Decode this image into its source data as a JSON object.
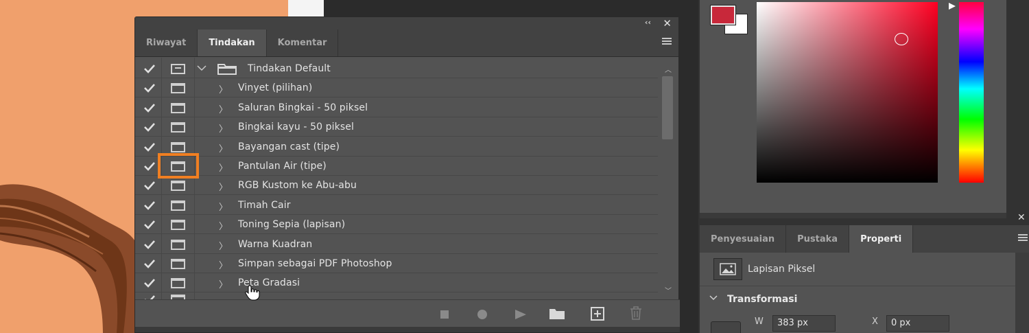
{
  "actions_panel": {
    "tabs": [
      {
        "label": "Riwayat",
        "active": false
      },
      {
        "label": "Tindakan",
        "active": true
      },
      {
        "label": "Komentar",
        "active": false
      }
    ],
    "action_set": "Tindakan Default",
    "actions": [
      "Vinyet (pilihan)",
      "Saluran Bingkai - 50 piksel",
      "Bingkai kayu - 50 piksel",
      "Bayangan cast (tipe)",
      "Pantulan Air (tipe)",
      "RGB Kustom ke Abu-abu",
      "Timah Cair",
      "Toning Sepia (lapisan)",
      "Warna Kuadran",
      "Simpan sebagai PDF Photoshop",
      "Peta Gradasi"
    ],
    "highlighted_action_index": 4,
    "footer_buttons": [
      "stop-icon",
      "record-icon",
      "play-icon",
      "new-set-folder-icon",
      "new-action-icon",
      "delete-icon"
    ]
  },
  "color_panel": {
    "foreground_color": "#c8283a",
    "background_color": "#ffffff"
  },
  "properties_panel": {
    "tabs": [
      {
        "label": "Penyesuaian",
        "active": false
      },
      {
        "label": "Pustaka",
        "active": false
      },
      {
        "label": "Properti",
        "active": true
      }
    ],
    "layer_type": "Lapisan Piksel",
    "section": "Transformasi",
    "w_label": "W",
    "w_value": "383 px",
    "x_label": "X",
    "x_value": "0 px"
  },
  "colors": {
    "highlight": "#f07f22",
    "panel_bg": "#535353",
    "canvas_bg": "#f0a06c"
  }
}
